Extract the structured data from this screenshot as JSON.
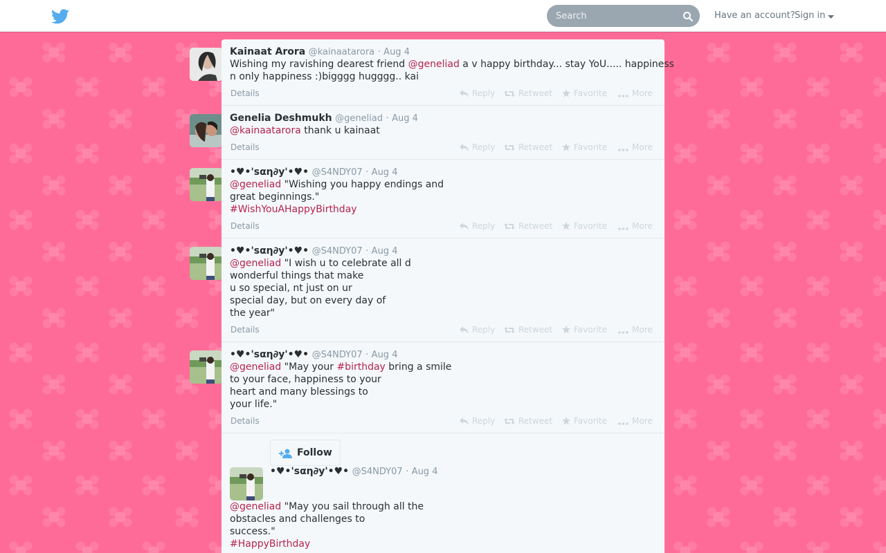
{
  "topbar": {
    "search_placeholder": "Search",
    "have_account": "Have an account?",
    "sign_in": "Sign in"
  },
  "tweets": [
    {
      "fullname": "Kainaat Arora",
      "username": "@kainaatarora",
      "dot": "·",
      "time": "Aug 4",
      "text_lines": [
        [
          {
            "t": "Wishing my ravishing dearest friend ",
            "k": "plain"
          },
          {
            "t": "@geneliad",
            "k": "mention"
          },
          {
            "t": " a v happy birthday... stay YoU..... happiness",
            "k": "plain"
          }
        ],
        [
          {
            "t": "n only happiness :)bigggg hugggg.. kai",
            "k": "plain"
          }
        ]
      ]
    },
    {
      "fullname": "Genelia Deshmukh",
      "username": "@geneliad",
      "dot": "·",
      "time": "Aug 4",
      "text_lines": [
        [
          {
            "t": "@kainaatarora",
            "k": "mention"
          },
          {
            "t": " thank u kainaat",
            "k": "plain"
          }
        ]
      ]
    },
    {
      "fullname": "•♥•'ѕαη∂у'•♥•",
      "username": "@S4NDY07",
      "dot": "·",
      "time": "Aug 4",
      "text_lines": [
        [
          {
            "t": "@geneliad",
            "k": "mention"
          },
          {
            "t": " \"Wishing you happy endings and",
            "k": "plain"
          }
        ],
        [
          {
            "t": "great beginnings.\"",
            "k": "plain"
          }
        ],
        [
          {
            "t": "#WishYouAHappyBirthday",
            "k": "hashtag"
          }
        ]
      ]
    },
    {
      "fullname": "•♥•'ѕαη∂у'•♥•",
      "username": "@S4NDY07",
      "dot": "·",
      "time": "Aug 4",
      "text_lines": [
        [
          {
            "t": "@geneliad",
            "k": "mention"
          },
          {
            "t": " \"I wish u to celebrate all d",
            "k": "plain"
          }
        ],
        [
          {
            "t": "wonderful things that make",
            "k": "plain"
          }
        ],
        [
          {
            "t": "u so special, nt just on ur",
            "k": "plain"
          }
        ],
        [
          {
            "t": "special day, but on every day of",
            "k": "plain"
          }
        ],
        [
          {
            "t": "the year\"",
            "k": "plain"
          }
        ]
      ]
    },
    {
      "fullname": "•♥•'ѕαη∂у'•♥•",
      "username": "@S4NDY07",
      "dot": "·",
      "time": "Aug 4",
      "text_lines": [
        [
          {
            "t": "@geneliad",
            "k": "mention"
          },
          {
            "t": " \"May your ",
            "k": "plain"
          },
          {
            "t": "#birthday",
            "k": "hashtag"
          },
          {
            "t": " bring a smile",
            "k": "plain"
          }
        ],
        [
          {
            "t": "to your face, happiness to your",
            "k": "plain"
          }
        ],
        [
          {
            "t": "heart and many blessings to",
            "k": "plain"
          }
        ],
        [
          {
            "t": "your life.\"",
            "k": "plain"
          }
        ]
      ]
    },
    {
      "fullname": "•♥•'ѕαη∂у'•♥•",
      "username": "@S4NDY07",
      "dot": "·",
      "time": "Aug 4",
      "text_lines": [
        [
          {
            "t": "@geneliad",
            "k": "mention"
          },
          {
            "t": " \"May you sail through all the",
            "k": "plain"
          }
        ],
        [
          {
            "t": "obstacles and challenges to",
            "k": "plain"
          }
        ],
        [
          {
            "t": "success.\"",
            "k": "plain"
          }
        ],
        [
          {
            "t": "#HappyBirthday",
            "k": "hashtag"
          }
        ]
      ]
    }
  ],
  "actions": {
    "details": "Details",
    "reply": "Reply",
    "retweet": "Retweet",
    "favorite": "Favorite",
    "more": "More"
  },
  "follow": {
    "label": "Follow"
  },
  "colors": {
    "background": "#ff6b98",
    "link": "#b5234f",
    "twitter_blue": "#55acee"
  }
}
